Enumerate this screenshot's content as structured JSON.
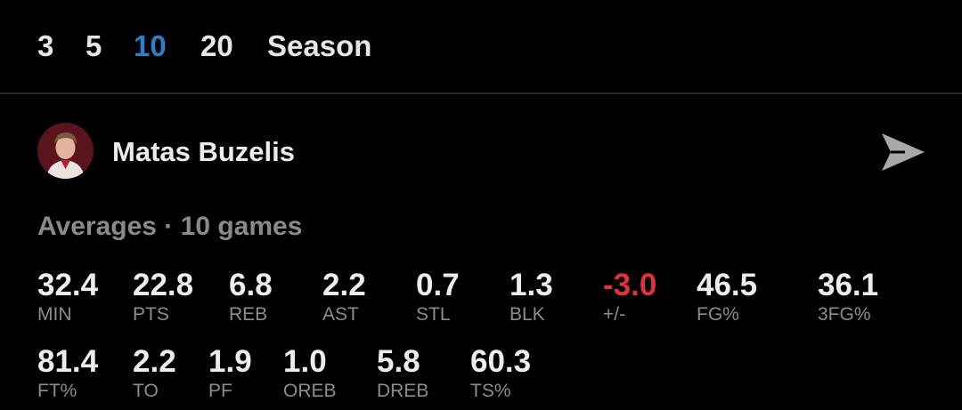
{
  "tabs": [
    {
      "label": "3"
    },
    {
      "label": "5"
    },
    {
      "label": "10"
    },
    {
      "label": "20"
    },
    {
      "label": "Season"
    }
  ],
  "active_tab": "10",
  "accent_color": "#2f7fc8",
  "negative_color": "#e0323a",
  "player": {
    "name": "Matas Buzelis",
    "avatar_icon": "player-headshot",
    "share_icon": "send-icon"
  },
  "averages": {
    "title": "Averages · 10 games",
    "stats": [
      {
        "label": "MIN",
        "value": "32.4"
      },
      {
        "label": "PTS",
        "value": "22.8"
      },
      {
        "label": "REB",
        "value": "6.8"
      },
      {
        "label": "AST",
        "value": "2.2"
      },
      {
        "label": "STL",
        "value": "0.7"
      },
      {
        "label": "BLK",
        "value": "1.3"
      },
      {
        "label": "+/-",
        "value": "-3.0",
        "negative": true
      },
      {
        "label": "FG%",
        "value": "46.5"
      },
      {
        "label": "3FG%",
        "value": "36.1"
      },
      {
        "label": "FT%",
        "value": "81.4"
      },
      {
        "label": "TO",
        "value": "2.2"
      },
      {
        "label": "PF",
        "value": "1.9"
      },
      {
        "label": "OREB",
        "value": "1.0"
      },
      {
        "label": "DREB",
        "value": "5.8"
      },
      {
        "label": "TS%",
        "value": "60.3"
      }
    ]
  }
}
